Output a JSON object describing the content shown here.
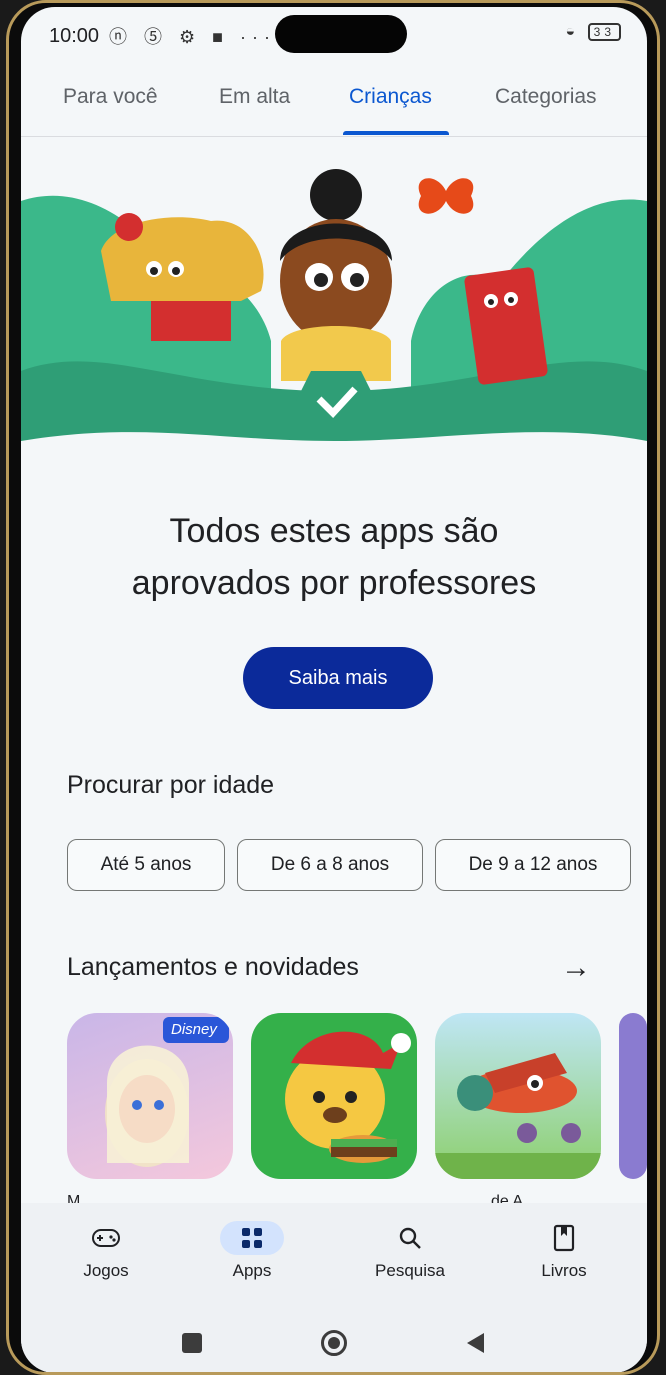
{
  "status_bar": {
    "time": "10:00",
    "battery": "33"
  },
  "tabs": [
    {
      "label": "Para você"
    },
    {
      "label": "Em alta"
    },
    {
      "label": "Crianças"
    },
    {
      "label": "Categorias"
    }
  ],
  "hero": {
    "title_line1": "Todos estes apps são",
    "title_line2": "aprovados por professores",
    "cta_label": "Saiba mais"
  },
  "age_section": {
    "title": "Procurar por idade",
    "chips": [
      {
        "label": "Até 5 anos"
      },
      {
        "label": "De 6 a 8 anos"
      },
      {
        "label": "De 9 a 12 anos"
      }
    ]
  },
  "new_section": {
    "title": "Lançamentos e novidades",
    "apps": [
      {
        "name": "M",
        "icon": "frozen-app-icon",
        "badge": "Disney"
      },
      {
        "name": "",
        "icon": "bear-burger-app-icon"
      },
      {
        "name": "de A",
        "icon": "airplane-app-icon"
      }
    ]
  },
  "bottom_nav": [
    {
      "label": "Jogos",
      "icon": "gamepad-icon"
    },
    {
      "label": "Apps",
      "icon": "apps-grid-icon"
    },
    {
      "label": "Pesquisa",
      "icon": "search-icon"
    },
    {
      "label": "Livros",
      "icon": "book-icon"
    }
  ],
  "colors": {
    "accent": "#0b57d0",
    "cta": "#0b2a9a",
    "active_pill": "#d3e3fd"
  }
}
